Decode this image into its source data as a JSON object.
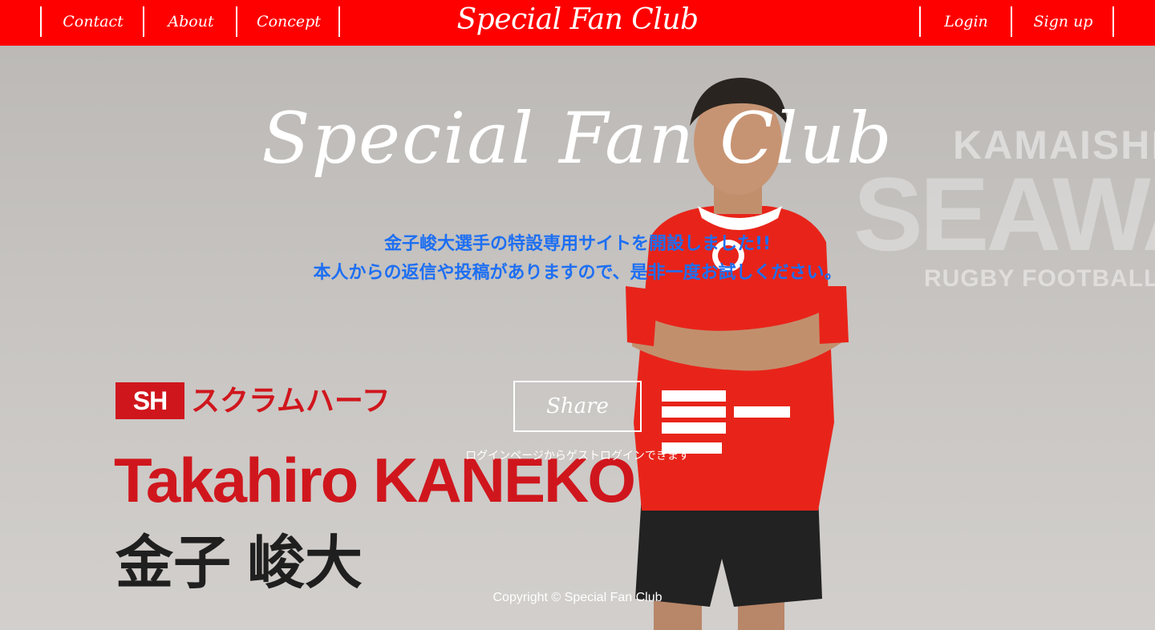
{
  "header": {
    "nav_left": [
      {
        "label": "Contact"
      },
      {
        "label": "About"
      },
      {
        "label": "Concept"
      }
    ],
    "brand": "Special Fan Club",
    "nav_right": [
      {
        "label": "Login"
      },
      {
        "label": "Sign up"
      }
    ]
  },
  "hero": {
    "title": "Special Fan Club",
    "message_line1": "金子峻大選手の特設専用サイトを開設しました!!",
    "message_line2": "本人からの返信や投稿がありますので、是非一度お試しください。",
    "share_label": "Share",
    "guest_note": "ログインページからゲストログインできます"
  },
  "background": {
    "watermark_line1": "KAMAISHI",
    "watermark_line2": "SEAWAVES",
    "watermark_line3": "RUGBY FOOTBALL",
    "position_code": "SH",
    "position_name": "スクラムハーフ",
    "player_name_en": "Takahiro KANEKO",
    "player_name_ja": "金子 峻大"
  },
  "footer": {
    "copyright": "Copyright © Special Fan Club"
  },
  "colors": {
    "header_bg": "#ff0000",
    "message_text": "#1e6ff2",
    "accent_red": "#d0161d"
  }
}
